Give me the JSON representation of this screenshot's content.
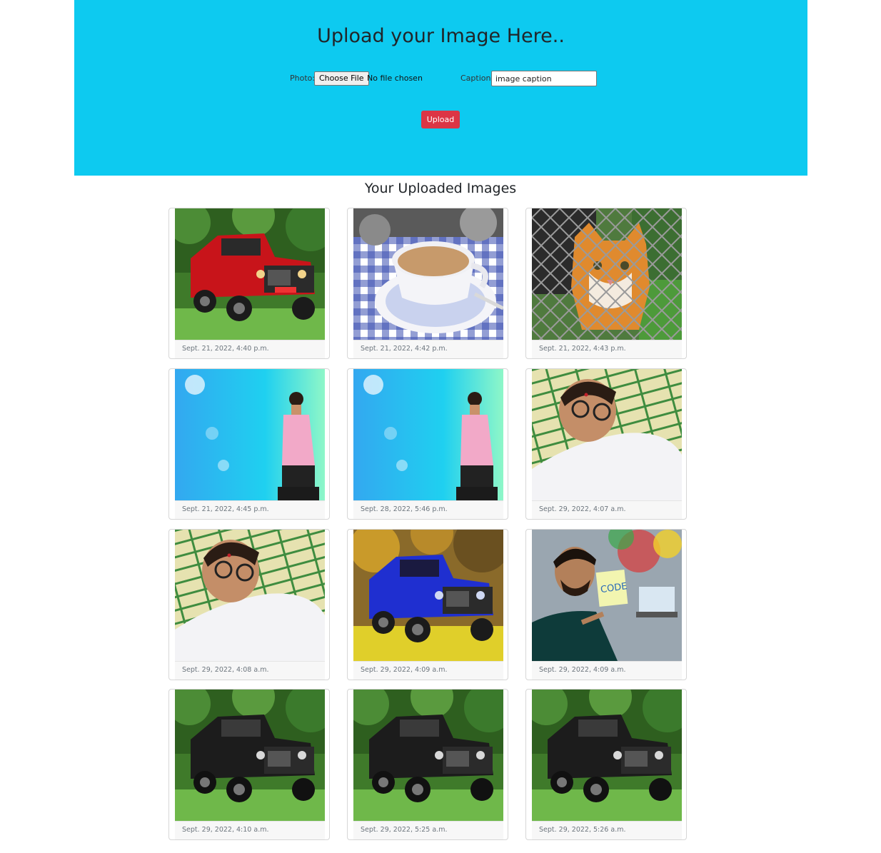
{
  "header": {
    "title": "Upload your Image Here..",
    "photo_label": "Photo:",
    "choose_file_label": "Choose File",
    "file_status": "No file chosen",
    "caption_label": "Caption:",
    "caption_value": "image caption",
    "upload_label": "Upload",
    "background_color": "#0dcaf0",
    "upload_color": "#dc3545"
  },
  "gallery": {
    "title": "Your Uploaded Images",
    "cards": [
      {
        "date": "Sept. 21, 2022, 4:40 p.m.",
        "subject": "red-jeep-photo"
      },
      {
        "date": "Sept. 21, 2022, 4:42 p.m.",
        "subject": "tea-cup-photo"
      },
      {
        "date": "Sept. 21, 2022, 4:43 p.m.",
        "subject": "cat-behind-fence-photo"
      },
      {
        "date": "Sept. 21, 2022, 4:45 p.m.",
        "subject": "man-pink-shirt-photo"
      },
      {
        "date": "Sept. 28, 2022, 5:46 p.m.",
        "subject": "man-pink-shirt-photo"
      },
      {
        "date": "Sept. 29, 2022, 4:07 a.m.",
        "subject": "man-selfie-photo"
      },
      {
        "date": "Sept. 29, 2022, 4:08 a.m.",
        "subject": "man-selfie-photo"
      },
      {
        "date": "Sept. 29, 2022, 4:09 a.m.",
        "subject": "blue-jeep-photo"
      },
      {
        "date": "Sept. 29, 2022, 4:09 a.m.",
        "subject": "code-note-photo"
      },
      {
        "date": "Sept. 29, 2022, 4:10 a.m.",
        "subject": "black-jeep-photo"
      },
      {
        "date": "Sept. 29, 2022, 5:25 a.m.",
        "subject": "black-jeep-photo"
      },
      {
        "date": "Sept. 29, 2022, 5:26 a.m.",
        "subject": "black-jeep-photo"
      }
    ]
  }
}
